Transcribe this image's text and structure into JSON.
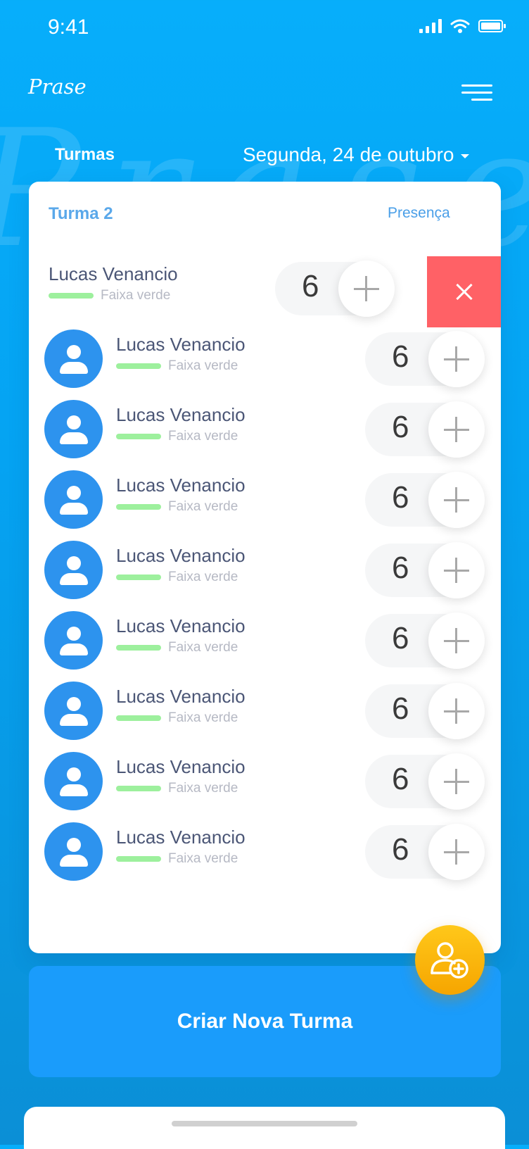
{
  "status_bar": {
    "time": "9:41"
  },
  "header": {
    "logo": "Prase",
    "tab": "Turmas",
    "date": "Segunda, 24 de outubro",
    "watermark": "Prase"
  },
  "class_card": {
    "title": "Turma 2",
    "presence_label": "Presença",
    "swiped_student": {
      "name": "Lucas Venancio",
      "belt": "Faixa verde",
      "count": "6"
    },
    "students": [
      {
        "name": "Lucas Venancio",
        "belt": "Faixa verde",
        "count": "6"
      },
      {
        "name": "Lucas Venancio",
        "belt": "Faixa verde",
        "count": "6"
      },
      {
        "name": "Lucas Venancio",
        "belt": "Faixa verde",
        "count": "6"
      },
      {
        "name": "Lucas Venancio",
        "belt": "Faixa verde",
        "count": "6"
      },
      {
        "name": "Lucas Venancio",
        "belt": "Faixa verde",
        "count": "6"
      },
      {
        "name": "Lucas Venancio",
        "belt": "Faixa verde",
        "count": "6"
      },
      {
        "name": "Lucas Venancio",
        "belt": "Faixa verde",
        "count": "6"
      },
      {
        "name": "Lucas Venancio",
        "belt": "Faixa verde",
        "count": "6"
      }
    ]
  },
  "actions": {
    "create_class": "Criar Nova Turma"
  },
  "colors": {
    "background": "#07aefb",
    "accent": "#2d93ee",
    "belt_green": "#9df09d",
    "delete": "#ff6166",
    "fab": "#ffc81a"
  }
}
